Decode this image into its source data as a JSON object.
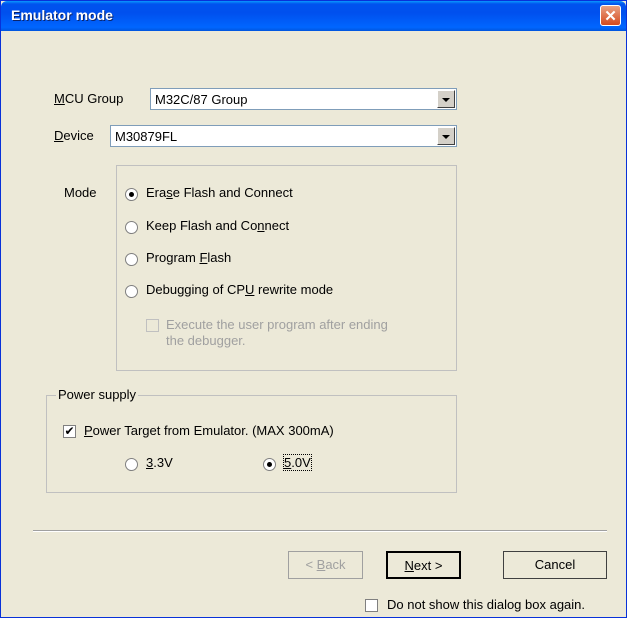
{
  "window": {
    "title": "Emulator mode",
    "close_glyph": "✕"
  },
  "mcu_group": {
    "label": "MCU Group",
    "value": "M32C/87 Group"
  },
  "device": {
    "label": "Device",
    "value": "M30879FL"
  },
  "mode": {
    "label": "Mode",
    "options": [
      {
        "label": "Erase Flash and Connect",
        "selected": true
      },
      {
        "label": "Keep Flash and Connect",
        "selected": false
      },
      {
        "label": "Program Flash",
        "selected": false
      },
      {
        "label": "Debugging of CPU rewrite mode",
        "selected": false
      }
    ],
    "execute_after_line1": "Execute the user program after ending",
    "execute_after_line2": "the debugger."
  },
  "power_supply": {
    "label": "Power supply",
    "power_target_label": "Power Target from Emulator. (MAX 300mA)",
    "power_target_checked": true,
    "voltage_3_3": "3.3V",
    "voltage_5_0": "5.0V",
    "selected_voltage": "5.0V"
  },
  "buttons": {
    "back": "< Back",
    "next": "Next >",
    "cancel": "Cancel"
  },
  "footer": {
    "do_not_show_label": "Do not show this dialog box again."
  }
}
